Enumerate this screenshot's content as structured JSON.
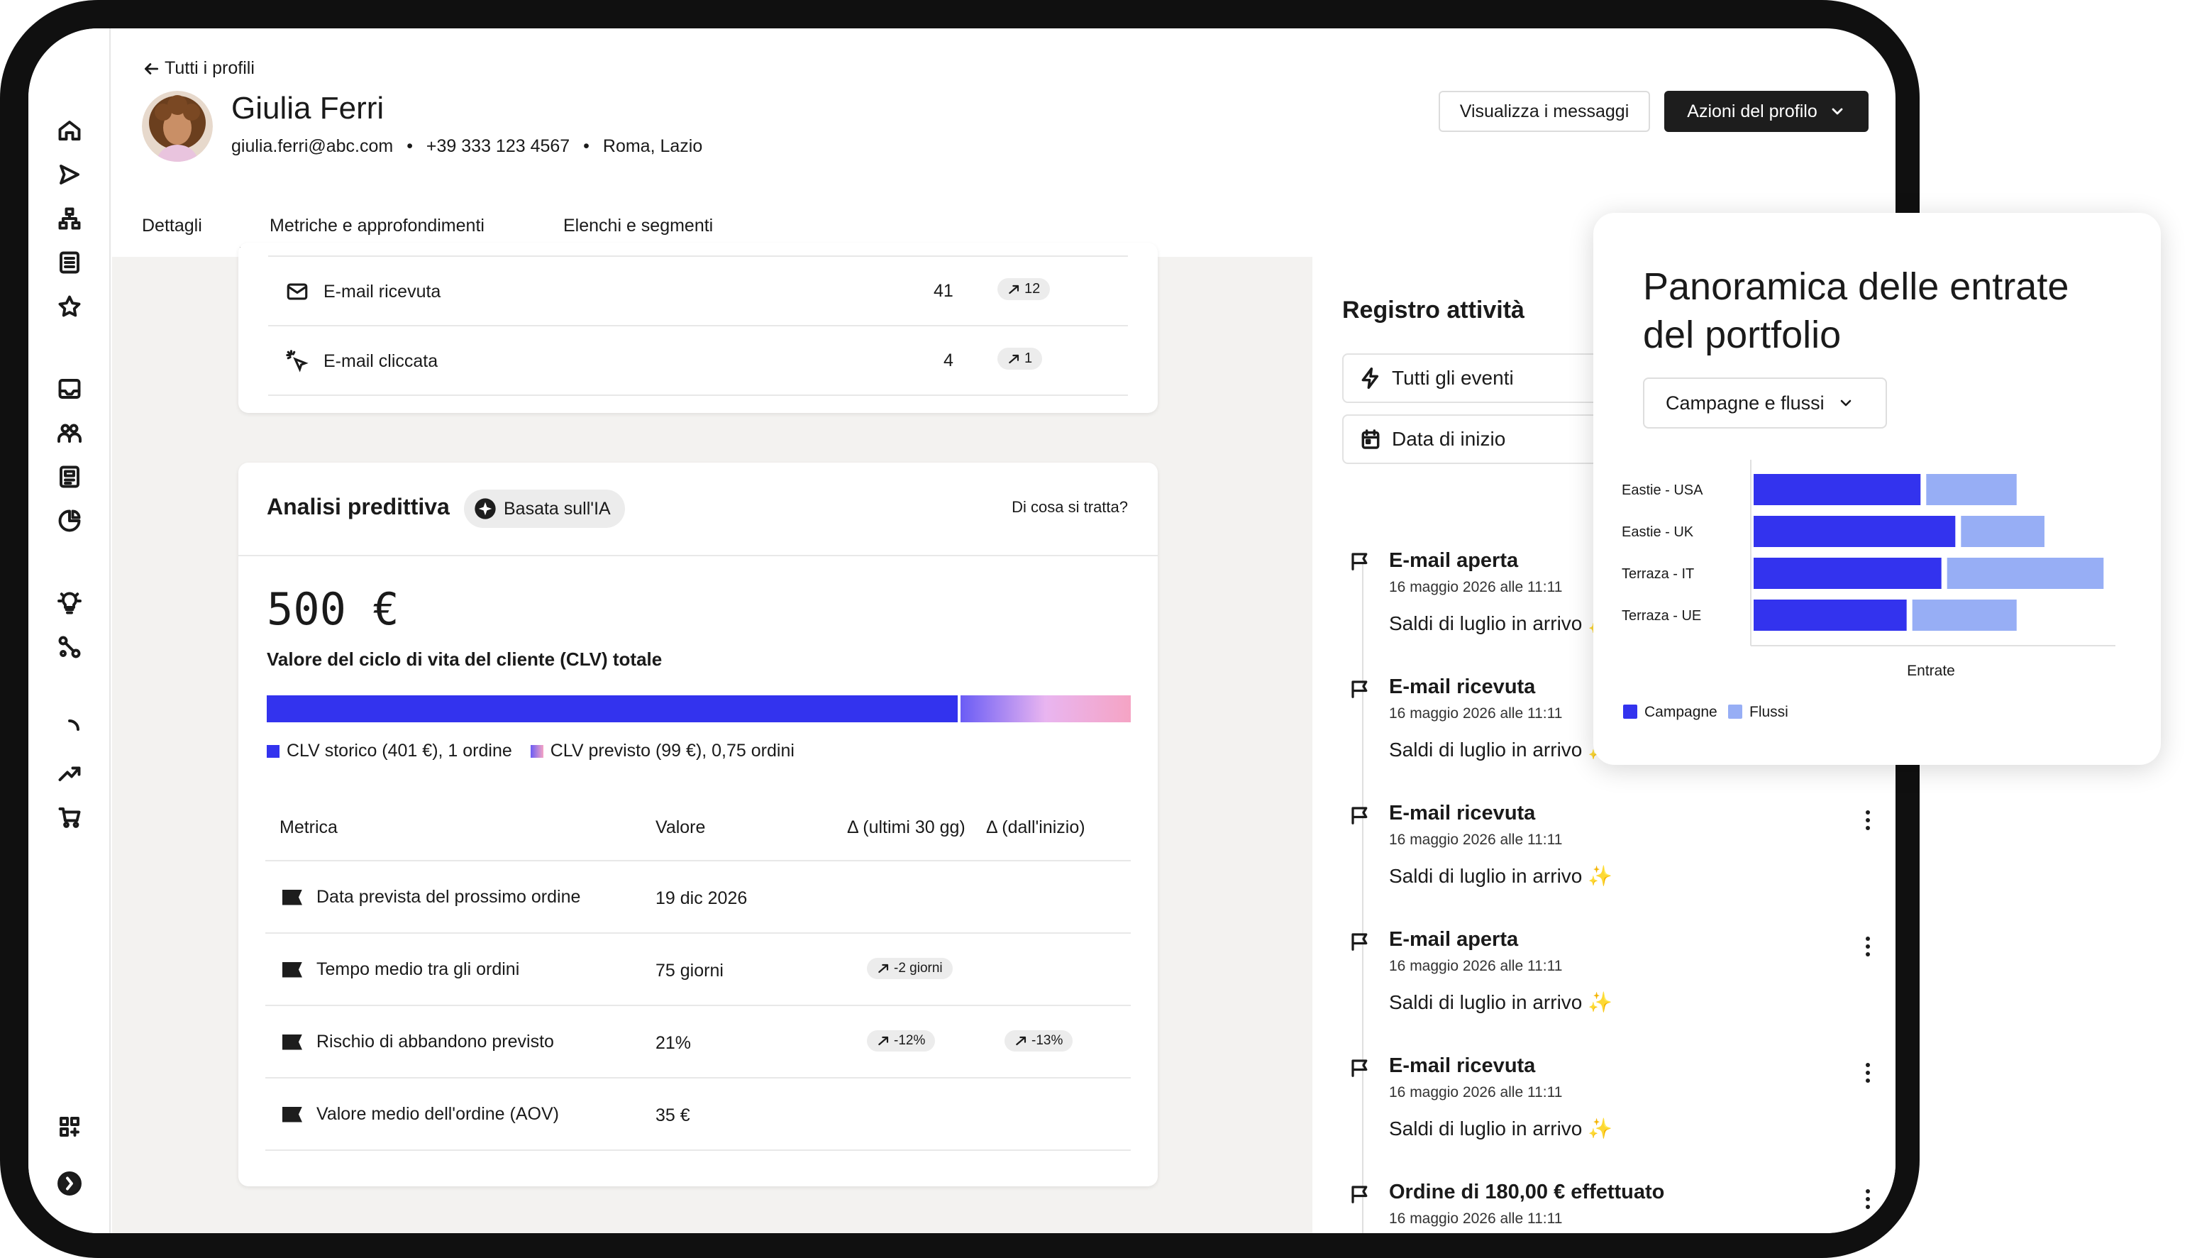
{
  "header": {
    "back_label": "Tutti i profili",
    "name": "Giulia Ferri",
    "email": "giulia.ferri@abc.com",
    "phone": "+39 333 123 4567",
    "location": "Roma, Lazio",
    "sep": "•",
    "view_messages": "Visualizza i messaggi",
    "profile_actions": "Azioni del profilo"
  },
  "tabs": [
    {
      "label": "Dettagli"
    },
    {
      "label": "Metriche e approfondimenti"
    },
    {
      "label": "Elenchi e segmenti"
    }
  ],
  "email_stats": [
    {
      "label": "E-mail ricevuta",
      "value": "41",
      "delta": "12"
    },
    {
      "label": "E-mail cliccata",
      "value": "4",
      "delta": "1"
    }
  ],
  "predictive": {
    "title": "Analisi predittiva",
    "ai_badge": "Basata sull'IA",
    "help_link": "Di cosa si tratta?",
    "clv_value": "500 €",
    "clv_label": "Valore del ciclo di vita del cliente (CLV) totale",
    "historical_fraction": 0.8,
    "legend_historical": "CLV storico (401 €), 1 ordine",
    "legend_predicted": "CLV previsto (99 €), 0,75 ordini",
    "col_metric": "Metrica",
    "col_value": "Valore",
    "col_delta30": "Δ (ultimi 30 gg)",
    "col_delta_all": "Δ (dall'inizio)",
    "rows": [
      {
        "metric": "Data prevista del prossimo ordine",
        "value": "19 dic 2026",
        "d30": "",
        "dall": ""
      },
      {
        "metric": "Tempo medio tra gli ordini",
        "value": "75 giorni",
        "d30": "-2 giorni",
        "dall": ""
      },
      {
        "metric": "Rischio di abbandono previsto",
        "value": "21%",
        "d30": "-12%",
        "dall": "-13%"
      },
      {
        "metric": "Valore medio dell'ordine (AOV)",
        "value": "35 €",
        "d30": "",
        "dall": ""
      }
    ]
  },
  "activity": {
    "title": "Registro attività",
    "filter_events": "Tutti gli eventi",
    "filter_date": "Data di inizio",
    "items": [
      {
        "title": "E-mail aperta",
        "time": "16 maggio 2026 alle 11:11",
        "desc": "Saldi di luglio in arrivo ✨"
      },
      {
        "title": "E-mail ricevuta",
        "time": "16 maggio 2026 alle 11:11",
        "desc": "Saldi di luglio in arrivo ✨"
      },
      {
        "title": "E-mail ricevuta",
        "time": "16 maggio 2026 alle 11:11",
        "desc": "Saldi di luglio in arrivo ✨"
      },
      {
        "title": "E-mail aperta",
        "time": "16 maggio 2026 alle 11:11",
        "desc": "Saldi di luglio in arrivo ✨"
      },
      {
        "title": "E-mail ricevuta",
        "time": "16 maggio 2026 alle 11:11",
        "desc": "Saldi di luglio in arrivo ✨"
      },
      {
        "title": "Ordine di 180,00 € effettuato",
        "time": "16 maggio 2026 alle 11:11",
        "desc": ""
      }
    ]
  },
  "revenue_panel": {
    "title_line1": "Panoramica delle entrate",
    "title_line2": "del portfolio",
    "dropdown": "Campagne e flussi"
  },
  "chart_data": {
    "type": "bar",
    "orientation": "horizontal",
    "stacked": true,
    "categories": [
      "Eastie - USA",
      "Eastie - UK",
      "Terraza - IT",
      "Terraza - UE"
    ],
    "series": [
      {
        "name": "Campagne",
        "values": [
          48,
          58,
          54,
          44
        ],
        "color": "#3333ee"
      },
      {
        "name": "Flussi",
        "values": [
          26,
          24,
          45,
          30
        ],
        "color": "#97aef5"
      }
    ],
    "xlabel": "Entrate",
    "xlim": [
      0,
      102
    ],
    "legend": "bottom-left",
    "grid": false
  }
}
